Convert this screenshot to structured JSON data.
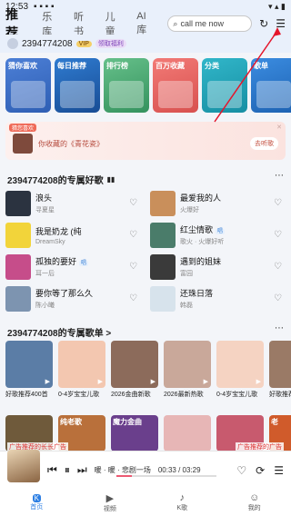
{
  "status": {
    "time": "12:53",
    "right": "▾ ▴ ▮"
  },
  "tabs": [
    "推荐",
    "乐库",
    "听书",
    "儿童",
    "AI库"
  ],
  "search": {
    "placeholder": "call me now"
  },
  "user": {
    "name": "2394774208",
    "vip": "VIP",
    "gift": "领取福利"
  },
  "categories": [
    {
      "label": "猜你喜欢"
    },
    {
      "label": "每日推荐"
    },
    {
      "label": "排行榜"
    },
    {
      "label": "百万收藏"
    },
    {
      "label": "分类"
    },
    {
      "label": "歌单"
    }
  ],
  "banner": {
    "tag": "猜您喜欢",
    "text": "你收藏的《青花瓷》",
    "button": "去听歌"
  },
  "section1": {
    "title": "2394774208的专属好歌",
    "more": "⋯"
  },
  "songs": [
    {
      "title": "浪头",
      "artist": "寻夏星",
      "color": "#2b3340",
      "tag": ""
    },
    {
      "title": "最爱我的人",
      "artist": "火爆好",
      "color": "#c98f5b",
      "tag": ""
    },
    {
      "title": "我是奶龙 (纯",
      "artist": "DreamSky",
      "color": "#f2d43a",
      "tag": ""
    },
    {
      "title": "红尘情歌",
      "artist": "歌火 · 火爆好听",
      "color": "#4a7c6a",
      "tag": "唱"
    },
    {
      "title": "孤独的要好",
      "artist": "耳一后",
      "color": "#c64d8a",
      "tag": "唱"
    },
    {
      "title": "遇到的姐妹",
      "artist": "富园",
      "color": "#3a3a3a",
      "tag": ""
    },
    {
      "title": "要你等了那么久",
      "artist": "陈小曦",
      "color": "#7d94b0",
      "tag": ""
    },
    {
      "title": "还珠日落",
      "artist": "韩磊",
      "color": "#d7e3ec",
      "tag": ""
    }
  ],
  "section2": {
    "title": "2394774208的专属歌单 >",
    "more": "⋯"
  },
  "playlists": [
    {
      "name": "好歌推荐400首",
      "color": "#5b7da6"
    },
    {
      "name": "0-4岁宝宝儿歌",
      "color": "#f3c7b0"
    },
    {
      "name": "2026金曲新歌",
      "color": "#8c6b5b"
    },
    {
      "name": "2026最新热歌",
      "color": "#c9a89a"
    },
    {
      "name": "0-4岁宝宝儿歌",
      "color": "#f5d3c2"
    },
    {
      "name": "好歌推荐",
      "color": "#9a7a66"
    }
  ],
  "row2": [
    {
      "label": "",
      "color": "#6f5a3b"
    },
    {
      "label": "纯老歌",
      "color": "#b9703b"
    },
    {
      "label": "魔力金曲",
      "color": "#6a3f8c"
    },
    {
      "label": "",
      "color": "#e7b6b6"
    },
    {
      "label": "",
      "color": "#c85a6e"
    },
    {
      "label": "老",
      "color": "#d05b2b"
    }
  ],
  "ads": {
    "left": "广告推荐的长长广告",
    "right": "广告推荐的广告"
  },
  "player": {
    "song": "暖 · 暖 · 悲剧一场",
    "time": "00:33 / 03:29",
    "progress": 0.15
  },
  "bottomnav": [
    {
      "label": "首页",
      "icon": "K"
    },
    {
      "label": "视频",
      "icon": "▶"
    },
    {
      "label": "K歌",
      "icon": "♪"
    },
    {
      "label": "我的",
      "icon": "☺"
    }
  ]
}
